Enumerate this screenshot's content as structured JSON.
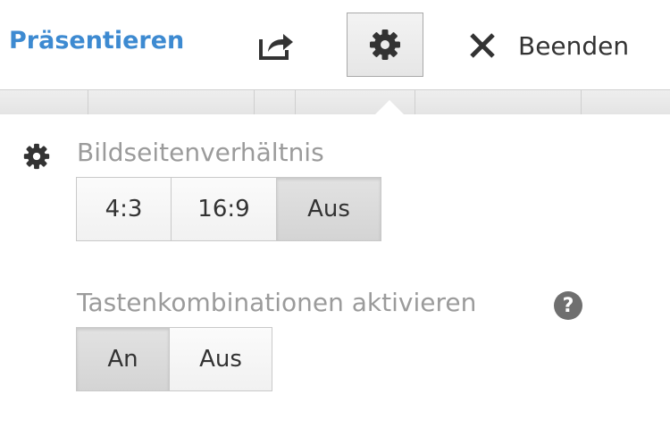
{
  "toolbar": {
    "present_label": "Präsentieren",
    "share_icon": "share-icon",
    "settings_icon": "gear-icon",
    "close_icon": "close-icon",
    "close_label": "Beenden",
    "accent_color": "#3d8ad1"
  },
  "settings": {
    "aspect_ratio": {
      "label": "Bildseitenverhältnis",
      "icon": "gear-icon",
      "options": [
        "4:3",
        "16:9",
        "Aus"
      ],
      "selected": "Aus"
    },
    "shortcuts": {
      "label": "Tastenkombinationen aktivieren",
      "help_icon": "help-icon",
      "help_glyph": "?",
      "options": [
        "An",
        "Aus"
      ],
      "selected": "An"
    }
  }
}
